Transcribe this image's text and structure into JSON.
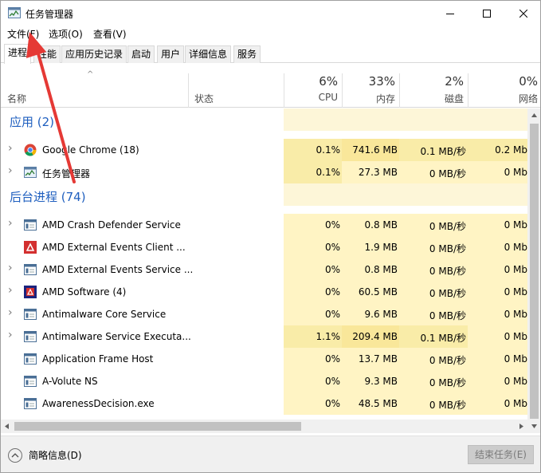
{
  "window": {
    "title": "任务管理器"
  },
  "menu": {
    "file": "文件(F)",
    "options": "选项(O)",
    "view": "查看(V)"
  },
  "tabs": [
    {
      "label": "进程"
    },
    {
      "label": "性能"
    },
    {
      "label": "应用历史记录"
    },
    {
      "label": "启动"
    },
    {
      "label": "用户"
    },
    {
      "label": "详细信息"
    },
    {
      "label": "服务"
    }
  ],
  "columns": {
    "name": "名称",
    "status": "状态",
    "cpu_pct": "6%",
    "cpu_label": "CPU",
    "mem_pct": "33%",
    "mem_label": "内存",
    "disk_pct": "2%",
    "disk_label": "磁盘",
    "net_pct": "0%",
    "net_label": "网络"
  },
  "groups": {
    "apps": "应用 (2)",
    "background": "后台进程 (74)"
  },
  "processes": [
    {
      "name": "Google Chrome (18)",
      "icon": "chrome-icon",
      "cpu": "0.1%",
      "mem": "741.6 MB",
      "disk": "0.1 MB/秒",
      "net": "0.2 Mb"
    },
    {
      "name": "任务管理器",
      "icon": "task-manager-icon",
      "cpu": "0.1%",
      "mem": "27.3 MB",
      "disk": "0 MB/秒",
      "net": "0 Mb"
    },
    {
      "name": "AMD Crash Defender Service",
      "icon": "service-icon",
      "cpu": "0%",
      "mem": "0.8 MB",
      "disk": "0 MB/秒",
      "net": "0 Mb"
    },
    {
      "name": "AMD External Events Client ...",
      "icon": "amd-icon",
      "cpu": "0%",
      "mem": "1.9 MB",
      "disk": "0 MB/秒",
      "net": "0 Mb"
    },
    {
      "name": "AMD External Events Service ...",
      "icon": "service-icon",
      "cpu": "0%",
      "mem": "0.8 MB",
      "disk": "0 MB/秒",
      "net": "0 Mb"
    },
    {
      "name": "AMD Software (4)",
      "icon": "amd-software-icon",
      "cpu": "0%",
      "mem": "60.5 MB",
      "disk": "0 MB/秒",
      "net": "0 Mb"
    },
    {
      "name": "Antimalware Core Service",
      "icon": "service-icon",
      "cpu": "0%",
      "mem": "9.6 MB",
      "disk": "0 MB/秒",
      "net": "0 Mb"
    },
    {
      "name": "Antimalware Service Executa...",
      "icon": "service-icon",
      "cpu": "1.1%",
      "mem": "209.4 MB",
      "disk": "0.1 MB/秒",
      "net": "0 Mb"
    },
    {
      "name": "Application Frame Host",
      "icon": "service-icon",
      "cpu": "0%",
      "mem": "13.7 MB",
      "disk": "0 MB/秒",
      "net": "0 Mb"
    },
    {
      "name": "A-Volute NS",
      "icon": "service-icon",
      "cpu": "0%",
      "mem": "9.3 MB",
      "disk": "0 MB/秒",
      "net": "0 Mb"
    },
    {
      "name": "AwarenessDecision.exe",
      "icon": "service-icon",
      "cpu": "0%",
      "mem": "48.5 MB",
      "disk": "0 MB/秒",
      "net": "0 Mb"
    }
  ],
  "footer": {
    "fewer_details": "简略信息(D)",
    "end_task": "结束任务(E)"
  },
  "colors": {
    "group_title": "#1f5fbf",
    "heat_light": "#fff4c4",
    "heat_medium": "#f9eca8",
    "annotation_arrow": "#e53935"
  }
}
